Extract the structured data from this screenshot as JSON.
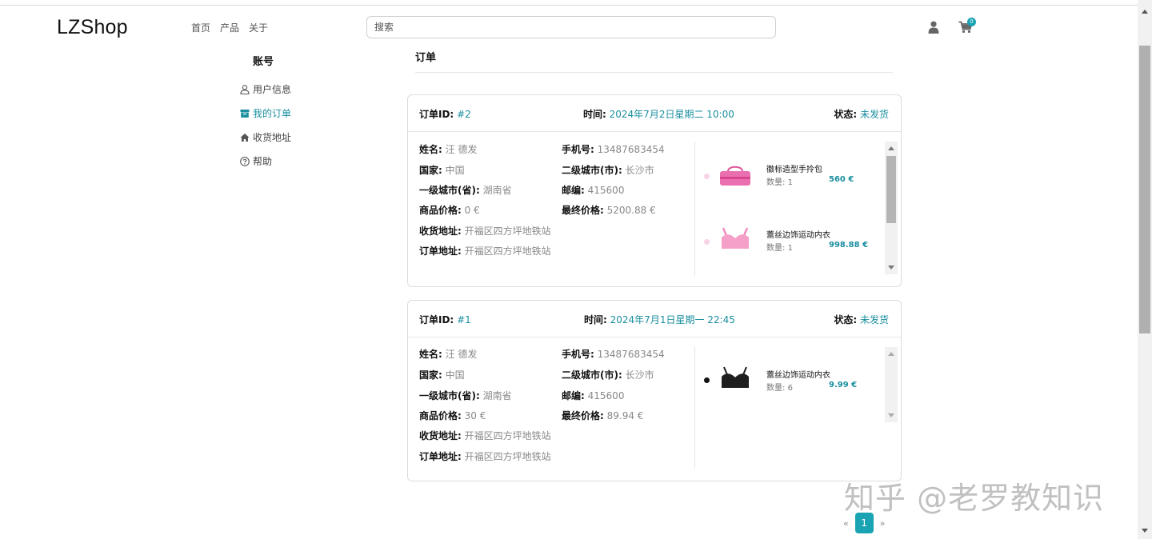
{
  "header": {
    "logo": "LZShop",
    "nav": [
      "首页",
      "产品",
      "关于"
    ],
    "search_placeholder": "搜索",
    "cart_count": "0"
  },
  "sidebar": {
    "title": "账号",
    "items": [
      {
        "label": "用户信息",
        "icon": "user-icon",
        "active": false
      },
      {
        "label": "我的订单",
        "icon": "archive-box-icon",
        "active": true
      },
      {
        "label": "收货地址",
        "icon": "home-icon",
        "active": false
      },
      {
        "label": "帮助",
        "icon": "question-circle-icon",
        "active": false
      }
    ]
  },
  "main": {
    "title": "订单",
    "labels": {
      "order_id": "订单ID:",
      "time": "时间:",
      "status": "状态:",
      "name": "姓名:",
      "phone": "手机号:",
      "country": "国家:",
      "city2": "二级城市(市):",
      "city1": "一级城市(省):",
      "zip": "邮编:",
      "goods_price": "商品价格:",
      "final_price": "最终价格:",
      "ship_addr": "收货地址:",
      "order_addr": "订单地址:",
      "qty": "数量:"
    },
    "orders": [
      {
        "id": "#2",
        "time": "2024年7月2日星期二 10:00",
        "status": "未发货",
        "name": "汪 德发",
        "phone": "13487683454",
        "country": "中国",
        "city2": "长沙市",
        "city1": "湖南省",
        "zip": "415600",
        "goods_price": "0 €",
        "final_price": "5200.88 €",
        "ship_addr": "开福区四方坪地铁站",
        "order_addr": "开福区四方坪地铁站",
        "products": [
          {
            "name": "徽标造型手拎包",
            "qty": "1",
            "price": "560 €",
            "color_dot": "#f6d4e6"
          },
          {
            "name": "蕾丝边饰运动内衣",
            "qty": "1",
            "price": "998.88 €",
            "color_dot": "#f6d4e6"
          }
        ]
      },
      {
        "id": "#1",
        "time": "2024年7月1日星期一 22:45",
        "status": "未发货",
        "name": "汪 德发",
        "phone": "13487683454",
        "country": "中国",
        "city2": "长沙市",
        "city1": "湖南省",
        "zip": "415600",
        "goods_price": "30 €",
        "final_price": "89.94 €",
        "ship_addr": "开福区四方坪地铁站",
        "order_addr": "开福区四方坪地铁站",
        "products": [
          {
            "name": "蕾丝边饰运动内衣",
            "qty": "6",
            "price": "9.99 €",
            "color_dot": "#111111"
          }
        ]
      }
    ]
  },
  "pagination": {
    "prev": "«",
    "current": "1",
    "next": "»"
  },
  "watermark": "知乎 @老罗教知识",
  "colors": {
    "accent": "#1a8fa0",
    "badge": "#1aa3b2"
  }
}
